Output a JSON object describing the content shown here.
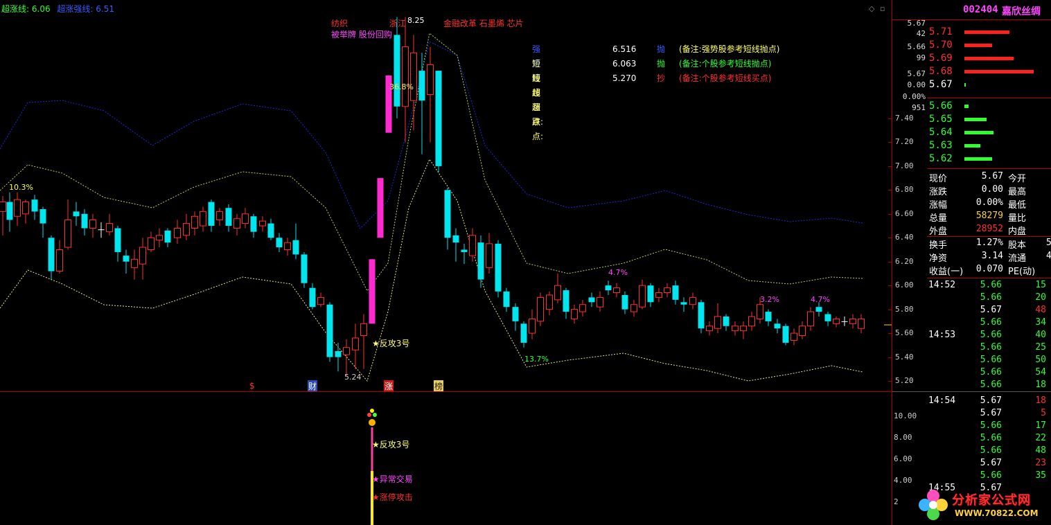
{
  "top_indicators": {
    "line1_label": "超涨线:",
    "line1_value": "6.06",
    "line2_label": "超涨强线:",
    "line2_value": "6.51"
  },
  "main_chart": {
    "price_labels": [
      "7.40",
      "7.20",
      "7.00",
      "6.80",
      "6.60",
      "6.40",
      "6.20",
      "6.00",
      "5.80",
      "5.60",
      "5.40",
      "5.20"
    ],
    "annotations": {
      "tags1": "纺织",
      "tags2": "被举牌 股份回购",
      "tags3": "浙江",
      "tags4": "金融改革 石墨烯 芯片",
      "high_mark": "8.25",
      "low_mark": "5.24",
      "pct_left": "10.3%",
      "pct_peak": "36.8%",
      "pct_low": "13.7%",
      "pct_a": "4.7%",
      "pct_b": "3.2%",
      "pct_c": "4.7%",
      "fangong": "★反攻3号"
    },
    "legend": [
      {
        "label": "强势股超涨点:",
        "value": "6.516",
        "action": "抛",
        "note": "(备注:强势股参考短线抛点)"
      },
      {
        "label": "短线超涨点:",
        "value": "6.063",
        "action": "抛",
        "note": "(备注:个股参考短线抛点)"
      },
      {
        "label": "短线超跌点:",
        "value": "5.270",
        "action": "抄",
        "note": "(备注:个股参考短线买点)"
      }
    ],
    "bottom_marks": [
      "$",
      "财",
      "涨",
      "榜"
    ]
  },
  "sub_chart": {
    "labels": [
      "10.00",
      "8.00",
      "6.00",
      "4.00",
      "2"
    ],
    "signals": [
      "★反攻3号",
      "★异常交易",
      "★涨停攻击"
    ]
  },
  "right_panel": {
    "stock_code": "002404",
    "stock_name": "嘉欣丝绸",
    "sell_orders": [
      {
        "price": "5.71",
        "fill": 0.62
      },
      {
        "price": "5.70",
        "fill": 0.38
      },
      {
        "price": "5.69",
        "fill": 0.68
      },
      {
        "price": "5.68",
        "fill": 0.95
      },
      {
        "price": "5.67",
        "fill": 0.02
      }
    ],
    "buy_orders": [
      {
        "price": "5.66",
        "fill": 0.06
      },
      {
        "price": "5.65",
        "fill": 0.3
      },
      {
        "price": "5.64",
        "fill": 0.4
      },
      {
        "price": "5.63",
        "fill": 0.22
      },
      {
        "price": "5.62",
        "fill": 0.38
      }
    ],
    "axis_left": [
      "5.67",
      "42",
      "5.66",
      "99",
      "5.67",
      "0.00",
      "0.00%",
      "951"
    ],
    "quote_rows": [
      {
        "k1": "现价",
        "v1": "5.67",
        "k2": "今开"
      },
      {
        "k1": "涨跌",
        "v1": "0.00",
        "k2": "最高"
      },
      {
        "k1": "涨幅",
        "v1": "0.00%",
        "k2": "最低"
      },
      {
        "k1": "总量",
        "v1": "58279",
        "k2": "量比"
      },
      {
        "k1": "外盘",
        "v1": "28952",
        "k2": "内盘"
      }
    ],
    "stats_rows": [
      {
        "k1": "换手",
        "v1": "1.27%",
        "k2": "股本",
        "v2": "5"
      },
      {
        "k1": "净资",
        "v1": "3.14",
        "k2": "流通",
        "v2": "4"
      },
      {
        "k1": "收益(一)",
        "v1": "0.070",
        "k2": "PE(动)",
        "v2": ""
      }
    ],
    "ticks": [
      {
        "time": "14:52",
        "price": "5.66",
        "vol": "15"
      },
      {
        "time": "",
        "price": "5.66",
        "vol": "20"
      },
      {
        "time": "",
        "price": "5.67",
        "vol": "48"
      },
      {
        "time": "",
        "price": "5.66",
        "vol": "34"
      },
      {
        "time": "14:53",
        "price": "5.66",
        "vol": "40"
      },
      {
        "time": "",
        "price": "5.66",
        "vol": "25"
      },
      {
        "time": "",
        "price": "5.66",
        "vol": "50"
      },
      {
        "time": "",
        "price": "5.66",
        "vol": "54"
      },
      {
        "time": "",
        "price": "5.66",
        "vol": "18"
      },
      {
        "time": "14:54",
        "price": "5.67",
        "vol": "18"
      },
      {
        "time": "",
        "price": "5.67",
        "vol": "5"
      },
      {
        "time": "",
        "price": "5.66",
        "vol": "17"
      },
      {
        "time": "",
        "price": "5.66",
        "vol": "22"
      },
      {
        "time": "",
        "price": "5.66",
        "vol": "48"
      },
      {
        "time": "",
        "price": "5.67",
        "vol": "23"
      },
      {
        "time": "",
        "price": "5.66",
        "vol": "35"
      },
      {
        "time": "14:55",
        "price": "5.67",
        "vol": ""
      }
    ]
  },
  "watermark": {
    "line1": "分析家公式网",
    "line2": "WWW.70822.COM"
  },
  "colors": {
    "up": "#ff3030",
    "down": "#00e5ee",
    "limit": "#ff2bd0",
    "upper_band": "#1a2bd8",
    "mid_band": "#b5d65a",
    "lower_band": "#e8e88a"
  }
}
